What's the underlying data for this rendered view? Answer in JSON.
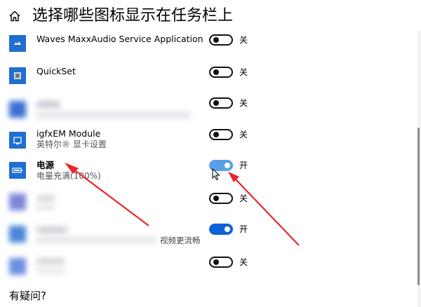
{
  "header": {
    "title": "选择哪些图标显示在任务栏上",
    "home_icon": "home-icon"
  },
  "apps": [
    {
      "name": "Waves MaxxAudio Service Application",
      "subtitle": "",
      "state": "off",
      "state_label": "关",
      "icon": "waves-app-icon",
      "blurred": false
    },
    {
      "name": "QuickSet",
      "subtitle": "",
      "state": "off",
      "state_label": "关",
      "icon": "quickset-app-icon",
      "blurred": false
    },
    {
      "name": "",
      "subtitle": "",
      "state": "off",
      "state_label": "关",
      "icon": "blurred-app-icon",
      "blurred": true
    },
    {
      "name": "igfxEM Module",
      "subtitle": "英特尔® 显卡设置",
      "state": "off",
      "state_label": "关",
      "icon": "intel-graphics-app-icon",
      "blurred": false
    },
    {
      "name": "电源",
      "subtitle": "电量充满(100%)",
      "state": "on",
      "state_label": "开",
      "icon": "battery-icon",
      "blurred": false
    },
    {
      "name": "",
      "subtitle": "",
      "state": "off",
      "state_label": "关",
      "icon": "blurred-app-icon",
      "blurred": true
    },
    {
      "name": "",
      "subtitle": "视频更流畅",
      "state": "on",
      "state_label": "开",
      "icon": "blurred-app-icon",
      "blurred": true
    },
    {
      "name": "",
      "subtitle": "",
      "state": "off",
      "state_label": "关",
      "icon": "blurred-app-icon",
      "blurred": true
    }
  ],
  "help": {
    "heading": "有疑问?"
  },
  "colors": {
    "toggle_on": "#0a64d6",
    "app_icon_bg": "#1e6fcf",
    "annotation_arrow": "#e8262b"
  }
}
